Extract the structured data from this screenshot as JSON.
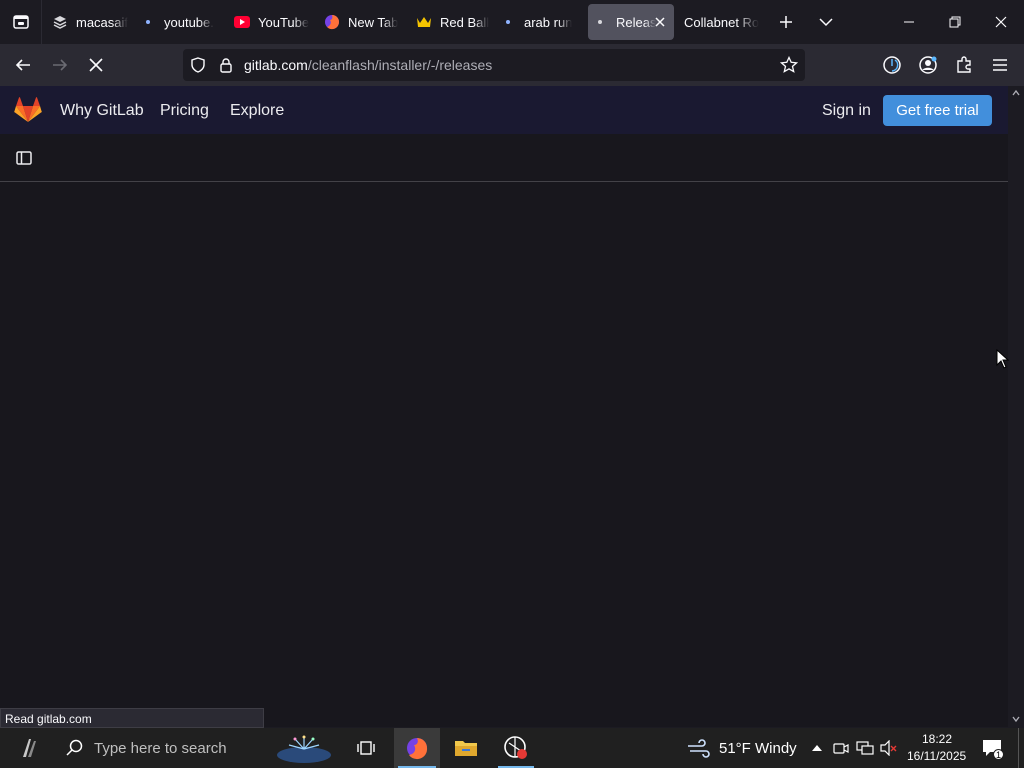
{
  "browser": {
    "tabs": [
      {
        "title": "macasaif",
        "icon": "stack-icon"
      },
      {
        "title": "youtube.",
        "icon": "loading-dot"
      },
      {
        "title": "YouTube",
        "icon": "youtube-icon"
      },
      {
        "title": "New Tab",
        "icon": "firefox-icon"
      },
      {
        "title": "Red Ball",
        "icon": "crown-icon"
      },
      {
        "title": "arab run",
        "icon": "loading-dot"
      },
      {
        "title": "Releas",
        "icon": "loading-dot",
        "active": true
      },
      {
        "title": "Collabnet Ro",
        "icon": "none"
      }
    ],
    "url_host": "gitlab.com",
    "url_path": "/cleanflash/installer/-/releases",
    "status_text": "Read gitlab.com"
  },
  "gitlab": {
    "nav": {
      "why": "Why GitLab",
      "pricing": "Pricing",
      "explore": "Explore",
      "sign_in": "Sign in",
      "trial": "Get free trial"
    }
  },
  "taskbar": {
    "search_placeholder": "Type here to search",
    "weather_temp": "51°F",
    "weather_desc": "Windy",
    "time": "18:22",
    "date": "16/11/2025",
    "notification_count": "1"
  },
  "colors": {
    "accent": "#428fdc",
    "header_bg": "#1a1931",
    "page_bg": "#18171d"
  }
}
